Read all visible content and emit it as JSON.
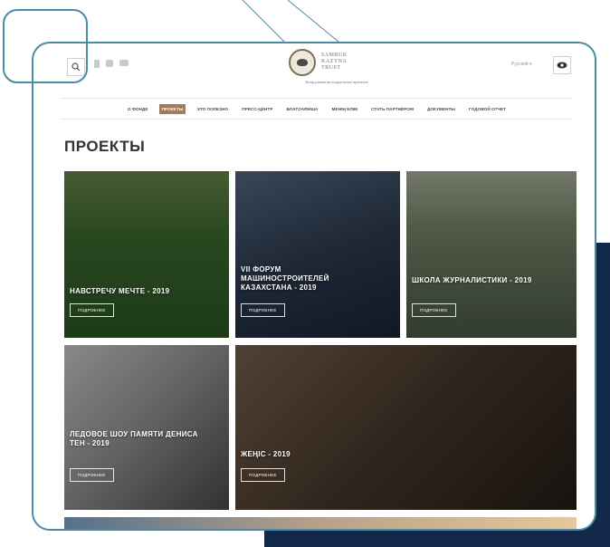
{
  "header": {
    "logo_text": "SAMRUK\nKAZYNA\nTRUST",
    "logo_tagline": "Фонд развития социальных проектов",
    "language": "Русский ▾"
  },
  "nav": {
    "items": [
      {
        "label": "О ФОНДЕ",
        "active": false
      },
      {
        "label": "ПРОЕКТЫ",
        "active": true
      },
      {
        "label": "ЭТО ПОЛЕЗНО",
        "active": false
      },
      {
        "label": "ПРЕСС-ЦЕНТР",
        "active": false
      },
      {
        "label": "БЛАГОАФИША",
        "active": false
      },
      {
        "label": "МЕНІҢ ЕЛІМ",
        "active": false
      },
      {
        "label": "СТАТЬ ПАРТНЁРОМ",
        "active": false
      },
      {
        "label": "ДОКУМЕНТЫ",
        "active": false
      },
      {
        "label": "ГОДОВОЙ ОТЧЕТ",
        "active": false
      }
    ]
  },
  "page": {
    "title": "ПРОЕКТЫ"
  },
  "projects": [
    {
      "title": "НАВСТРЕЧУ МЕЧТЕ - 2019",
      "more": "ПОДРОБНЕЕ"
    },
    {
      "title": "VII ФОРУМ МАШИНОСТРОИТЕЛЕЙ КАЗАХСТАНА - 2019",
      "more": "ПОДРОБНЕЕ"
    },
    {
      "title": "ШКОЛА ЖУРНАЛИСТИКИ - 2019",
      "more": "ПОДРОБНЕЕ"
    },
    {
      "title": "ЛЕДОВОЕ ШОУ ПАМЯТИ ДЕНИСА ТЕН - 2019",
      "more": "ПОДРОБНЕЕ"
    },
    {
      "title": "ЖЕҢІС - 2019",
      "more": "ПОДРОБНЕЕ"
    }
  ],
  "colors": {
    "accent": "#a27b5b",
    "frame": "#4d8aa3",
    "navy": "#13294b"
  },
  "icons": {
    "search": "search-icon",
    "eye": "eye-icon"
  }
}
